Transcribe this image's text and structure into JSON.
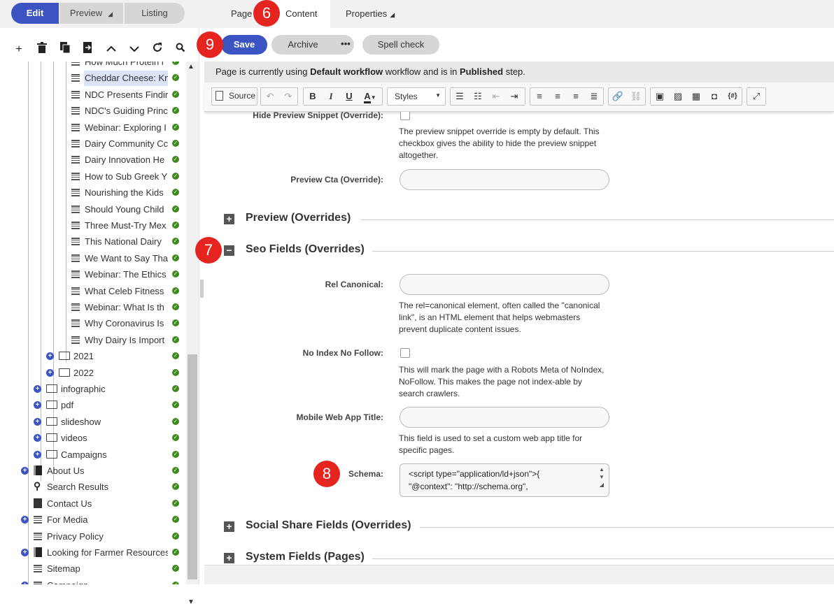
{
  "top": {
    "edit": "Edit",
    "preview": "Preview",
    "listing": "Listing",
    "tabs": {
      "page": "Page",
      "content": "Content",
      "properties": "Properties"
    }
  },
  "sidebar": {
    "tree": [
      {
        "label": "How Much Protein i",
        "type": "page",
        "level": 3
      },
      {
        "label": "Cheddar Cheese: Kn",
        "type": "page",
        "level": 3,
        "selected": true
      },
      {
        "label": "NDC Presents Findir",
        "type": "page",
        "level": 3
      },
      {
        "label": "NDC's Guiding Princ",
        "type": "page",
        "level": 3
      },
      {
        "label": "Webinar: Exploring I",
        "type": "page",
        "level": 3
      },
      {
        "label": "Dairy Community Cc",
        "type": "page",
        "level": 3
      },
      {
        "label": "Dairy Innovation He",
        "type": "page",
        "level": 3
      },
      {
        "label": "How to Sub Greek Y",
        "type": "page",
        "level": 3
      },
      {
        "label": "Nourishing the Kids",
        "type": "page",
        "level": 3
      },
      {
        "label": "Should Young Child",
        "type": "page",
        "level": 3
      },
      {
        "label": "Three Must-Try Mex",
        "type": "page",
        "level": 3
      },
      {
        "label": "This National Dairy",
        "type": "page",
        "level": 3
      },
      {
        "label": "We Want to Say Tha",
        "type": "page",
        "level": 3
      },
      {
        "label": "Webinar: The Ethics",
        "type": "page",
        "level": 3
      },
      {
        "label": "What Celeb Fitness",
        "type": "page",
        "level": 3
      },
      {
        "label": "Webinar: What Is th",
        "type": "page",
        "level": 3
      },
      {
        "label": "Why Coronavirus Is",
        "type": "page",
        "level": 3
      },
      {
        "label": "Why Dairy Is Import",
        "type": "page",
        "level": 3
      },
      {
        "label": "2021",
        "type": "folder",
        "level": 2
      },
      {
        "label": "2022",
        "type": "folder",
        "level": 2
      },
      {
        "label": "infographic",
        "type": "folder",
        "level": 1
      },
      {
        "label": "pdf",
        "type": "folder",
        "level": 1
      },
      {
        "label": "slideshow",
        "type": "folder",
        "level": 1
      },
      {
        "label": "videos",
        "type": "folder",
        "level": 1
      },
      {
        "label": "Campaigns",
        "type": "folder",
        "level": 1
      },
      {
        "label": "About Us",
        "type": "book",
        "level": 0,
        "expand": true
      },
      {
        "label": "Search Results",
        "type": "search",
        "level": 0
      },
      {
        "label": "Contact Us",
        "type": "doc",
        "level": 0
      },
      {
        "label": "For Media",
        "type": "page",
        "level": 0,
        "expand": true
      },
      {
        "label": "Privacy Policy",
        "type": "page",
        "level": 0
      },
      {
        "label": "Looking for Farmer Resources",
        "type": "book",
        "level": 0,
        "expand": true
      },
      {
        "label": "Sitemap",
        "type": "sitemap",
        "level": 0
      },
      {
        "label": "Campaign",
        "type": "page",
        "level": 0,
        "expand": true
      }
    ]
  },
  "main": {
    "save": "Save",
    "archive": "Archive",
    "more": "•••",
    "spell": "Spell check",
    "workflow": {
      "pre": "Page is currently using ",
      "name": "Default workflow",
      "mid": " workflow and is in ",
      "step": "Published",
      "post": " step."
    },
    "editor": {
      "source": "Source",
      "styles": "Styles"
    },
    "fields": {
      "hide_preview_label": "Hide Preview Snippet (Override):",
      "hide_preview_help": "The preview snippet override is empty by default. This checkbox gives the ability to hide the preview snippet altogether.",
      "preview_cta_label": "Preview Cta (Override):",
      "rel_canonical_label": "Rel Canonical:",
      "rel_canonical_help": "The rel=canonical element, often called the \"canonical link\", is an HTML element that helps webmasters prevent duplicate content issues.",
      "noindex_label": "No Index No Follow:",
      "noindex_help": "This will mark the page with a Robots Meta of NoIndex, NoFollow. This makes the page not index-able by search crawlers.",
      "mwat_label": "Mobile Web App Title:",
      "mwat_help": "This field is used to set a custom web app title for specific pages.",
      "schema_label": "Schema:",
      "schema_line1": "<script type=\"application/ld+json\">{",
      "schema_line2": "\"@context\": \"http://schema.org\","
    },
    "sections": {
      "preview": "Preview (Overrides)",
      "seo": "Seo Fields (Overrides)",
      "social": "Social Share Fields (Overrides)",
      "system": "System Fields (Pages)"
    }
  },
  "badges": {
    "b6": "6",
    "b7": "7",
    "b8": "8",
    "b9": "9"
  },
  "colors": {
    "accent": "#3b54c1",
    "badge": "#e52420",
    "ok": "#3f8a1d"
  }
}
